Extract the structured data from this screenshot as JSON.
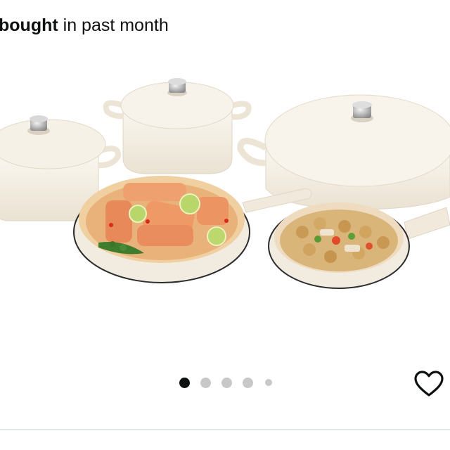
{
  "header": {
    "bought_bold": "bought",
    "bought_rest": " in past month"
  },
  "carousel": {
    "page_count": 5,
    "active_index": 0
  },
  "icons": {
    "wishlist": "heart-outline-icon"
  },
  "colors": {
    "active_dot": "#0f1111",
    "inactive_dot": "#c8c8c8",
    "cookware_enamel": "#f3ecdf"
  }
}
